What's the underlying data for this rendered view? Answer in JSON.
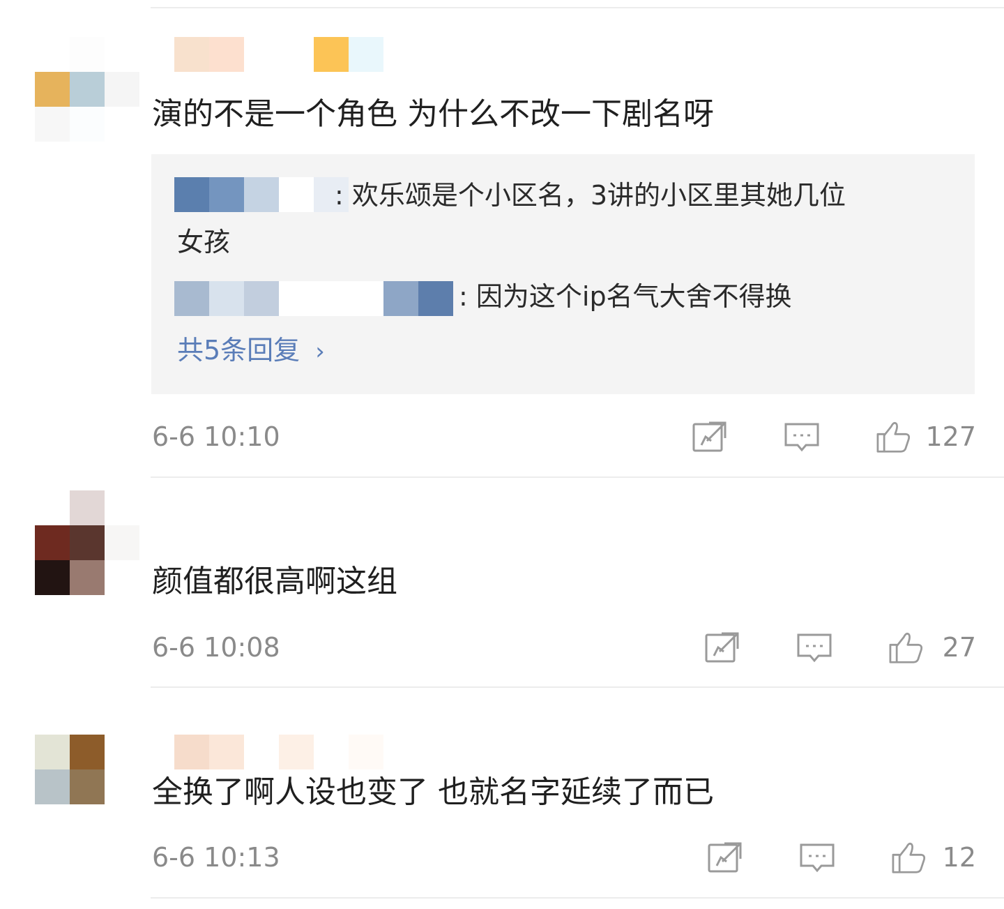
{
  "comments": [
    {
      "avatar_colors": [
        "#ffffff",
        "#fdfdfd",
        "#ffffff",
        "#e6b35c",
        "#b9ced8",
        "#f5f5f5",
        "#f7f7f7",
        "#fbfdfe",
        "#ffffff"
      ],
      "name_colors": [
        "#f8e1cd",
        "#fde0cf",
        "#ffffff",
        "#ffffff",
        "#fcc456",
        "#e9f7fc"
      ],
      "text": "演的不是一个角色 为什么不改一下剧名呀",
      "time": "6-6 10:10",
      "likes": "127",
      "replies": [
        {
          "name_colors": [
            "#5b7fae",
            "#7495bf",
            "#c5d3e3",
            "#ffffff",
            "#e8edf4"
          ],
          "text": ": 欢乐颂是个小区名，3讲的小区里其她几位",
          "text_cont": "女孩"
        },
        {
          "name_colors": [
            "#a8bad0",
            "#d8e2ed",
            "#c2cede",
            "#ffffff",
            "#ffffff",
            "#ffffff",
            "#8ea6c6",
            "#5d7eac"
          ],
          "text": ": 因为这个ip名气大舍不得换"
        }
      ],
      "more_replies": "共5条回复"
    },
    {
      "avatar_colors": [
        "#ffffff",
        "#e2d7d6",
        "#ffffff",
        "#6e2a20",
        "#5a362e",
        "#f7f6f5",
        "#221412",
        "#997a70",
        "#ffffff"
      ],
      "name_colors": [],
      "text": "颜值都很高啊这组",
      "time": "6-6 10:08",
      "likes": "27"
    },
    {
      "avatar_colors": [
        "#e3e4d6",
        "#8d5c2a",
        "#b8c3c8",
        "#907654"
      ],
      "name_colors": [
        "#ffffff",
        "#f6dccb",
        "#fbe7d9",
        "#ffffff",
        "#fdf0e6",
        "#ffffff",
        "#fffaf6"
      ],
      "text": "全换了啊人设也变了 也就名字延续了而已",
      "time": "6-6 10:13",
      "likes": "12"
    }
  ],
  "icons": {
    "repost": "repost-icon",
    "comment": "comment-icon",
    "like": "thumbs-up-icon"
  },
  "colors": {
    "link": "#5a7db8",
    "meta": "#8a8a8a",
    "reply_bg": "#f4f4f4"
  }
}
